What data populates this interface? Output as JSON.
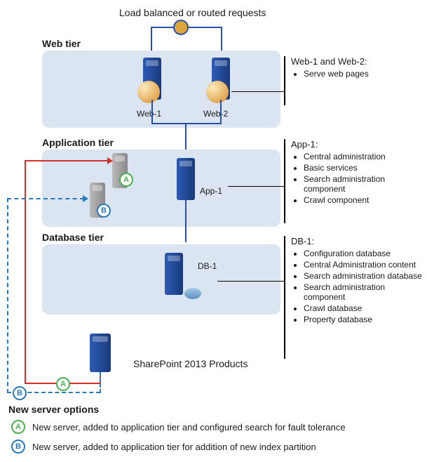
{
  "top_label": "Load balanced or routed requests",
  "lb_name": "load-balancer-icon",
  "tiers": {
    "web": {
      "title": "Web tier",
      "servers": [
        "Web-1",
        "Web-2"
      ],
      "annot_title": "Web-1 and Web-2:",
      "annot_items": [
        "Serve web pages"
      ]
    },
    "app": {
      "title": "Application tier",
      "server_main": "App-1",
      "annot_title": "App-1:",
      "annot_items": [
        "Central administration",
        "Basic services",
        "Search administration component",
        "Crawl  component"
      ]
    },
    "db": {
      "title": "Database tier",
      "server_main": "DB-1",
      "annot_title": "DB-1:",
      "annot_items": [
        "Configuration database",
        "Central Administration content",
        "Search administration database",
        "Search administration component",
        "Crawl  database",
        "Property database"
      ]
    }
  },
  "sp_label": "SharePoint 2013 Products",
  "legend": {
    "title": "New server options",
    "a": {
      "marker": "A",
      "text": "New server, added to application tier and configured search for fault tolerance"
    },
    "b": {
      "marker": "B",
      "text": "New server, added to application tier for addition of new index partition"
    }
  }
}
